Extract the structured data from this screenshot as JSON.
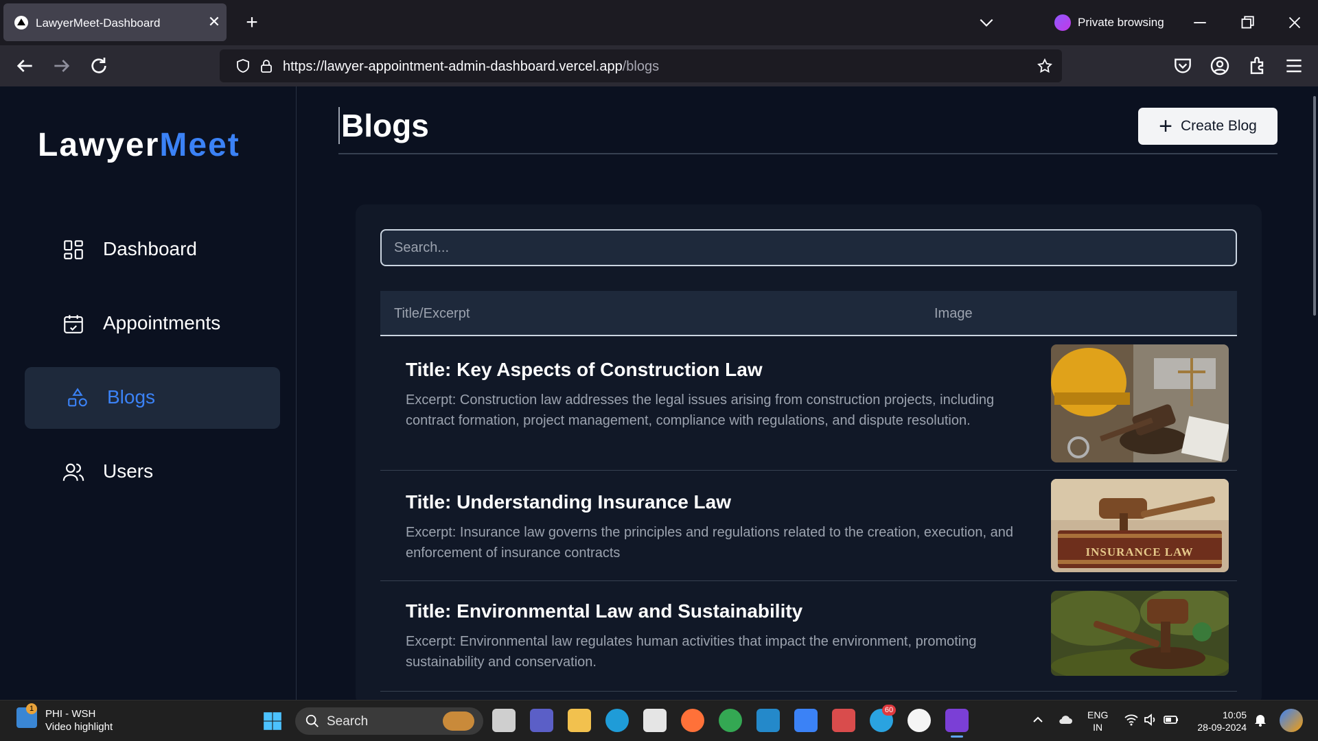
{
  "browser": {
    "tab_title": "LawyerMeet-Dashboard",
    "private_label": "Private browsing",
    "url_main": "https://lawyer-appointment-admin-dashboard.vercel.app",
    "url_path": "/blogs"
  },
  "sidebar": {
    "logo_part1": "Lawyer",
    "logo_part2": "Meet",
    "items": [
      {
        "label": "Dashboard",
        "icon": "dashboard-icon",
        "active": false
      },
      {
        "label": "Appointments",
        "icon": "calendar-icon",
        "active": false
      },
      {
        "label": "Blogs",
        "icon": "shapes-icon",
        "active": true
      },
      {
        "label": "Users",
        "icon": "users-icon",
        "active": false
      }
    ]
  },
  "main": {
    "title": "Blogs",
    "create_button_label": "Create Blog",
    "search_placeholder": "Search...",
    "columns": [
      "Title/Excerpt",
      "Image"
    ],
    "rows": [
      {
        "title": "Title: Key Aspects of Construction Law",
        "excerpt": "Excerpt: Construction law addresses the legal issues arising from construction projects, including contract formation, project management, compliance with regulations, and dispute resolution.",
        "image": "construction-law-image"
      },
      {
        "title": "Title: Understanding Insurance Law",
        "excerpt": "Excerpt: Insurance law governs the principles and regulations related to the creation, execution, and enforcement of insurance contracts",
        "image": "insurance-law-image",
        "image_text": "INSURANCE LAW"
      },
      {
        "title": "Title: Environmental Law and Sustainability",
        "excerpt": "Excerpt: Environmental law regulates human activities that impact the environment, promoting sustainability and conservation.",
        "image": "environmental-law-image"
      }
    ]
  },
  "taskbar": {
    "news_title": "PHI - WSH",
    "news_subtitle": "Video highlight",
    "news_badge": "1",
    "search_label": "Search",
    "telegram_badge": "60",
    "lang_line1": "ENG",
    "lang_line2": "IN",
    "time": "10:05",
    "date": "28-09-2024"
  },
  "colors": {
    "accent": "#3b82f6",
    "background": "#0b1120",
    "card": "#111827",
    "panel": "#1e293b"
  }
}
